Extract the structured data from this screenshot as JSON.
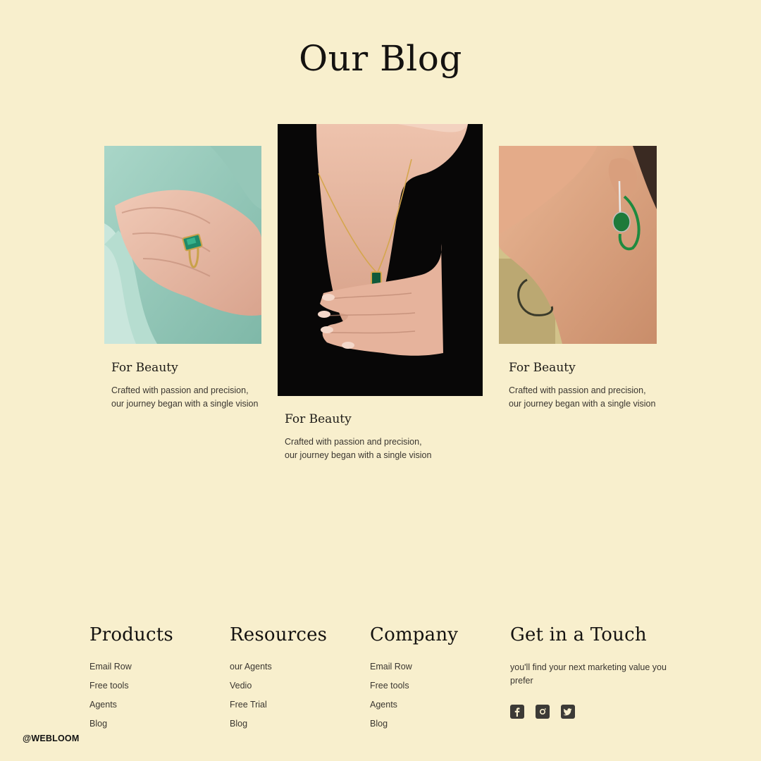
{
  "page": {
    "title": "Our Blog"
  },
  "cards": [
    {
      "title": "For Beauty",
      "text": "Crafted with passion and precision, our journey began with a single vision",
      "image": "emerald-ring-photo"
    },
    {
      "title": "For Beauty",
      "text": "Crafted with passion and precision, our journey began with a single vision",
      "image": "emerald-necklace-photo"
    },
    {
      "title": "For Beauty",
      "text": "Crafted with passion and precision, our journey began with a single vision",
      "image": "emerald-earring-photo"
    }
  ],
  "footer": {
    "products": {
      "heading": "Products",
      "links": [
        "Email Row",
        "Free tools",
        "Agents",
        "Blog"
      ]
    },
    "resources": {
      "heading": "Resources",
      "links": [
        "our Agents",
        "Vedio",
        "Free Trial",
        "Blog"
      ]
    },
    "company": {
      "heading": "Company",
      "links": [
        "Email Row",
        "Free tools",
        "Agents",
        "Blog"
      ]
    },
    "contact": {
      "heading": "Get in a Touch",
      "text": "you'll find your next marketing value you prefer",
      "social": [
        "facebook-icon",
        "instagram-icon",
        "twitter-icon"
      ]
    }
  },
  "watermark": "@WEBLOOM",
  "colors": {
    "background": "#f8efcd",
    "text": "#1c1a16",
    "icon": "#3c3a36"
  }
}
